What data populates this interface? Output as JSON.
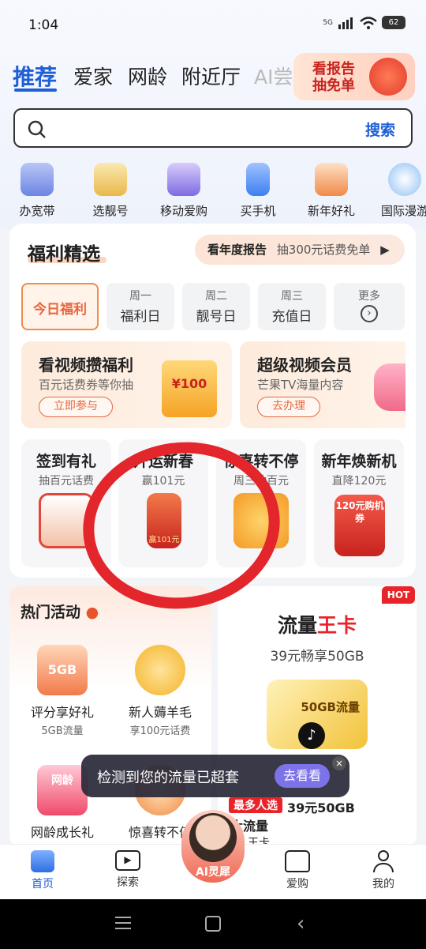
{
  "status_bar": {
    "time": "1:04",
    "network": "5G",
    "battery": "62"
  },
  "tabs": [
    {
      "label": "推荐",
      "active": true
    },
    {
      "label": "爱家"
    },
    {
      "label": "网龄"
    },
    {
      "label": "附近厅"
    },
    {
      "label": "AI尝"
    }
  ],
  "report_banner": {
    "line1": "看报告",
    "line2": "抽免单"
  },
  "search": {
    "placeholder": "",
    "button": "搜索"
  },
  "quick_icons": [
    {
      "label": "办宽带",
      "icon": "router-icon"
    },
    {
      "label": "选靓号",
      "icon": "sim-card-icon"
    },
    {
      "label": "移动爱购",
      "icon": "ai-cart-icon"
    },
    {
      "label": "买手机",
      "icon": "phone-icon"
    },
    {
      "label": "新年好礼",
      "icon": "gift-2025-icon"
    },
    {
      "label": "国际漫游",
      "icon": "airplane-icon"
    }
  ],
  "welfare": {
    "title": "福利精选",
    "pill_bold": "看年度报告",
    "pill_text": "抽300元话费免单",
    "day_tabs": [
      {
        "top": "",
        "label": "今日福利",
        "active": true
      },
      {
        "top": "周一",
        "label": "福利日"
      },
      {
        "top": "周二",
        "label": "靓号日"
      },
      {
        "top": "周三",
        "label": "充值日"
      },
      {
        "top": "更多",
        "label": ""
      }
    ],
    "promos": [
      {
        "title": "看视频攒福利",
        "sub": "百元话费券等你抽",
        "button": "立即参与",
        "img_text": "¥100"
      },
      {
        "title": "超级视频会员",
        "sub": "芒果TV海量内容",
        "button": "去办理"
      }
    ],
    "minis": [
      {
        "title": "签到有礼",
        "sub": "抽百元话费"
      },
      {
        "title": "开运新春",
        "sub": "赢101元",
        "img_text": "赢101元"
      },
      {
        "title": "惊喜转不停",
        "sub": "周三抽百元"
      },
      {
        "title": "新年焕新机",
        "sub": "直降120元",
        "img_text": "120元购机券"
      }
    ]
  },
  "hot": {
    "title": "热门活动",
    "badge": "HOT",
    "items": [
      {
        "title": "评分享好礼",
        "sub": "5GB流量",
        "img_text": "5GB"
      },
      {
        "title": "新人薅羊毛",
        "sub": "享100元话费"
      },
      {
        "title": "网龄成长礼",
        "sub": "",
        "img_text": "网龄"
      },
      {
        "title": "惊喜转不停",
        "sub": ""
      }
    ]
  },
  "flow_card": {
    "title_black": "流量",
    "title_red": "王卡",
    "sub": "39元畅享50GB",
    "img_text": "50GB流量",
    "tag": "最多人选",
    "price": "39元50GB",
    "line2": "大流量",
    "line3": "王卡"
  },
  "toast": {
    "text": "检测到您的流量已超套",
    "button": "去看看"
  },
  "bottom_nav": [
    {
      "label": "首页",
      "active": true
    },
    {
      "label": "探索"
    },
    {
      "label": "AI灵犀"
    },
    {
      "label": "爱购"
    },
    {
      "label": "我的"
    }
  ],
  "colors": {
    "brand_blue": "#1f5fd6",
    "accent_orange": "#e7663d",
    "hot_red": "#e8242a",
    "annotation_red": "#e2262b"
  }
}
